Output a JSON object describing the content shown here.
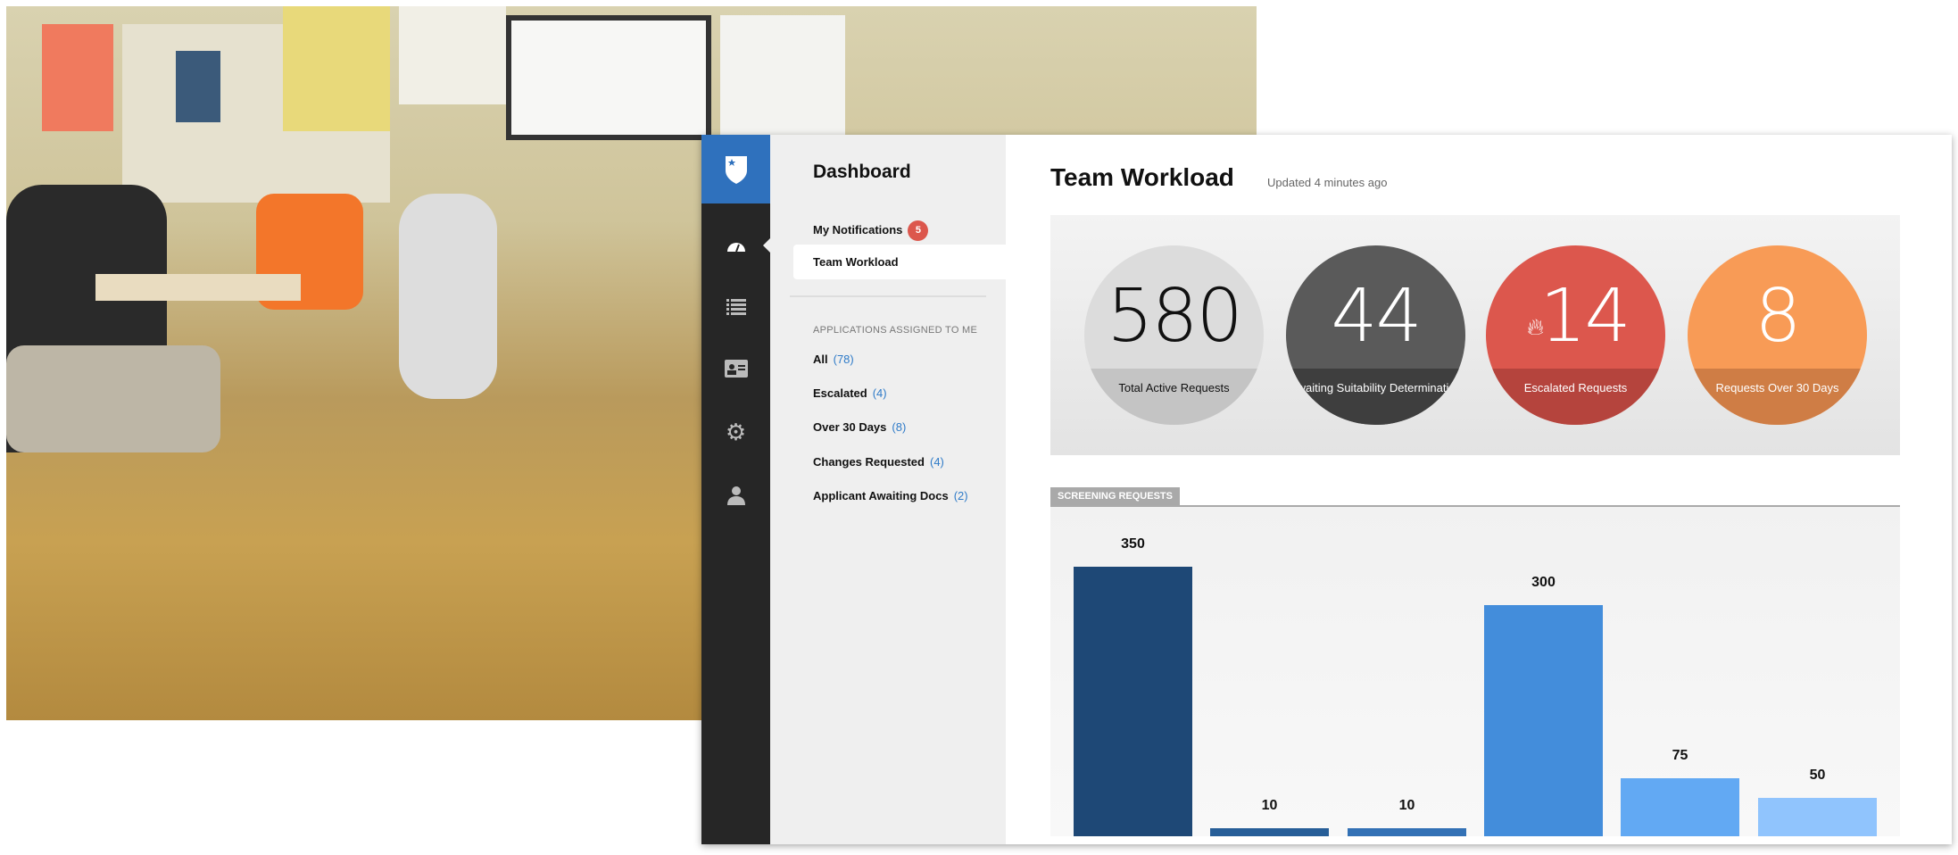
{
  "sidebar": {
    "icons": [
      "shield-star-icon",
      "dashboard-gauge-icon",
      "list-icon",
      "id-card-icon",
      "gear-icon",
      "user-icon"
    ]
  },
  "nav": {
    "title": "Dashboard",
    "notifications": {
      "label": "My Notifications",
      "badge": "5"
    },
    "team_workload": "Team Workload",
    "section_label": "APPLICATIONS ASSIGNED TO ME",
    "items": [
      {
        "label": "All",
        "count": "(78)"
      },
      {
        "label": "Escalated",
        "count": "(4)"
      },
      {
        "label": "Over 30 Days",
        "count": "(8)"
      },
      {
        "label": "Changes Requested",
        "count": "(4)"
      },
      {
        "label": "Applicant Awaiting Docs",
        "count": "(2)"
      }
    ]
  },
  "main": {
    "title": "Team Workload",
    "updated": "Updated 4 minutes ago",
    "stats": [
      {
        "value": "580",
        "label": "Total Active Requests",
        "top": "#dcdcdc",
        "bottom": "#c4c4c4",
        "text": "#111"
      },
      {
        "value": "44",
        "label": "Awaiting Suitability Determination",
        "top": "#5a5a5a",
        "bottom": "#3e3e3e",
        "text": "#fff"
      },
      {
        "value": "14",
        "label": "Escalated Requests",
        "icon": "fire-icon",
        "top": "#dc574d",
        "bottom": "#b5443d",
        "text": "#fff"
      },
      {
        "value": "8",
        "label": "Requests Over 30 Days",
        "top": "#f89b56",
        "bottom": "#cf7d45",
        "text": "#fff"
      }
    ],
    "screening_tab": "SCREENING REQUESTS"
  },
  "chart_data": {
    "type": "bar",
    "values": [
      350,
      10,
      10,
      300,
      75,
      50
    ],
    "colors": [
      "#1e4876",
      "#275e98",
      "#3371b5",
      "#438ddb",
      "#62a9f3",
      "#90c4fd"
    ]
  }
}
